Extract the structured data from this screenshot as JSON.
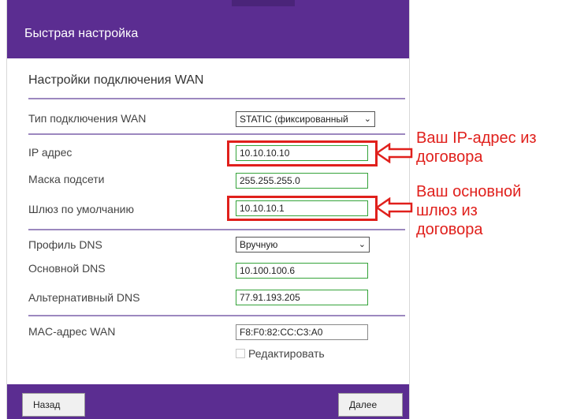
{
  "dialog": {
    "title": "Быстрая настройка",
    "section_title": "Настройки подключения WAN"
  },
  "wan_type": {
    "label": "Тип подключения WAN",
    "value": "STATIC (фиксированный"
  },
  "ip": {
    "label": "IP адрес",
    "value": "10.10.10.10"
  },
  "mask": {
    "label": "Маска подсети",
    "value": "255.255.255.0"
  },
  "gateway": {
    "label": "Шлюз по умолчанию",
    "value": "10.10.10.1"
  },
  "dns_profile": {
    "label": "Профиль DNS",
    "value": "Вручную"
  },
  "primary_dns": {
    "label": "Основной DNS",
    "value": "10.100.100.6"
  },
  "alt_dns": {
    "label": "Альтернативный DNS",
    "value": "77.91.193.205"
  },
  "mac": {
    "label": "MAC-адрес WAN",
    "value": "F8:F0:82:CC:C3:A0",
    "edit_label": "Редактировать",
    "edit_checked": false
  },
  "annotations": {
    "ip_note_line1": "Ваш IP-адрес из",
    "ip_note_line2": "договора",
    "gw_note_line1": "Ваш основной",
    "gw_note_line2": "шлюз из",
    "gw_note_line3": "договора",
    "color": "#e0201c"
  },
  "footer": {
    "back_label": "Назад",
    "next_label": "Далее"
  },
  "colors": {
    "brand": "#5b2d91",
    "field_border": "#35a33a"
  }
}
